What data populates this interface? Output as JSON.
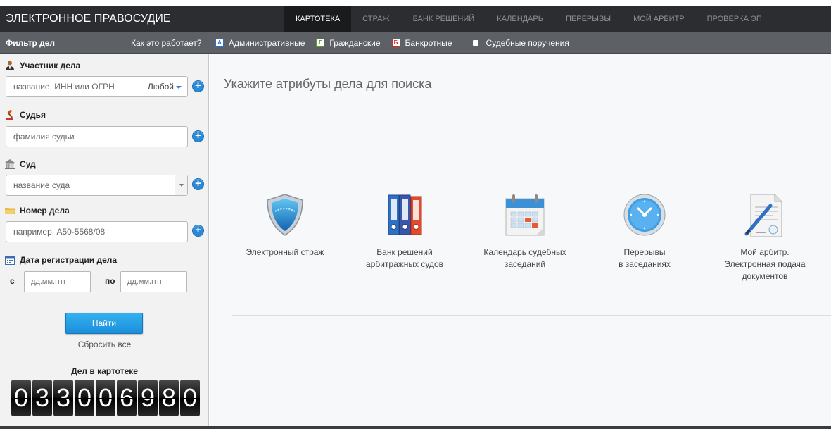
{
  "header": {
    "brand": "ЭЛЕКТРОННОЕ ПРАВОСУДИЕ",
    "nav": [
      {
        "label": "КАРТОТЕКА",
        "active": true
      },
      {
        "label": "СТРАЖ",
        "active": false
      },
      {
        "label": "БАНК РЕШЕНИЙ",
        "active": false
      },
      {
        "label": "КАЛЕНДАРЬ",
        "active": false
      },
      {
        "label": "ПЕРЕРЫВЫ",
        "active": false
      },
      {
        "label": "МОЙ АРБИТР",
        "active": false
      },
      {
        "label": "ПРОВЕРКА ЭП",
        "active": false
      }
    ]
  },
  "subbar": {
    "filter_title": "Фильтр дел",
    "how_link": "Как это работает?",
    "types": [
      {
        "badge": "А",
        "label": "Административные",
        "color": "#2a6fc9"
      },
      {
        "badge": "Г",
        "label": "Гражданские",
        "color": "#5a9a2a"
      },
      {
        "badge": "Б",
        "label": "Банкротные",
        "color": "#d02a2a"
      },
      {
        "badge": "",
        "label": "Судебные поручения",
        "color": "#ffffff"
      }
    ]
  },
  "filter": {
    "participant": {
      "label": "Участник дела",
      "placeholder": "название, ИНН или ОГРН",
      "select": "Любой"
    },
    "judge": {
      "label": "Судья",
      "placeholder": "фамилия судьи"
    },
    "court": {
      "label": "Суд",
      "placeholder": "название суда"
    },
    "case_number": {
      "label": "Номер дела",
      "placeholder": "например, А50-5568/08"
    },
    "reg_date": {
      "label": "Дата регистрации дела",
      "from_label": "с",
      "to_label": "по",
      "from_placeholder": "дд.мм.гггг",
      "to_placeholder": "дд.мм.гггг"
    },
    "find_button": "Найти",
    "reset_link": "Сбросить все",
    "count_title": "Дел в картотеке",
    "count_digits": [
      "0",
      "3",
      "3",
      "0",
      "0",
      "6",
      "9",
      "8",
      "0"
    ]
  },
  "main": {
    "title": "Укажите атрибуты дела для поиска",
    "tiles": [
      {
        "icon": "shield-icon",
        "label": "Электронный страж"
      },
      {
        "icon": "binders-icon",
        "label": "Банк решений\nарбитражных судов"
      },
      {
        "icon": "calendar-icon",
        "label": "Календарь судебных\nзаседаний"
      },
      {
        "icon": "clock-icon",
        "label": "Перерывы\nв заседаниях"
      },
      {
        "icon": "document-pen-icon",
        "label": "Мой арбитр.\nЭлектронная подача\nдокументов"
      }
    ]
  }
}
